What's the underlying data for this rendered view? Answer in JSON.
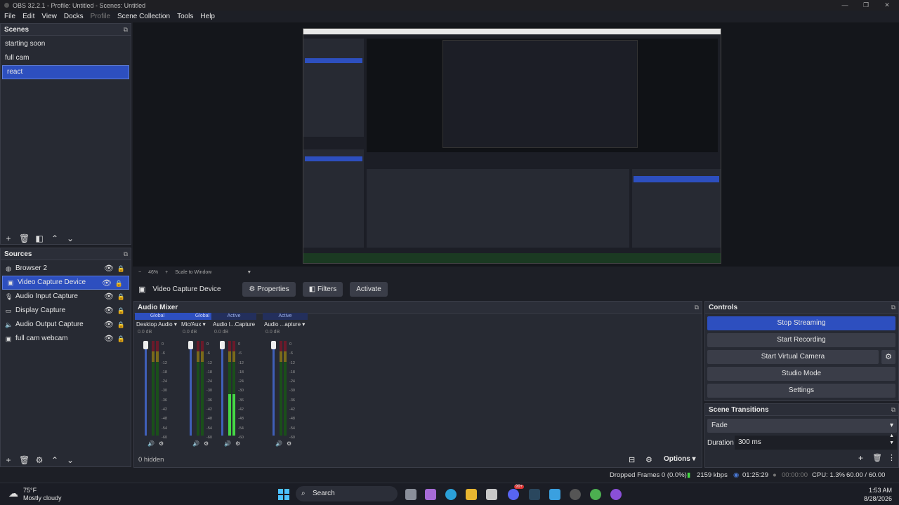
{
  "window": {
    "title": "OBS 32.2.1 - Profile: Untitled - Scenes: Untitled",
    "minimize": "—",
    "maximize": "❐",
    "close": "✕"
  },
  "menu": [
    "File",
    "Edit",
    "View",
    "Docks",
    "Profile",
    "Scene Collection",
    "Tools",
    "Help"
  ],
  "scenes": {
    "title": "Scenes",
    "items": [
      "starting soon",
      "full cam",
      "react"
    ],
    "selected": "react"
  },
  "sources": {
    "title": "Sources",
    "items": [
      {
        "label": "Browser 2",
        "icon": "globe-icon"
      },
      {
        "label": "Video Capture Device",
        "icon": "camera-icon"
      },
      {
        "label": "Audio Input Capture",
        "icon": "microphone-icon"
      },
      {
        "label": "Display Capture",
        "icon": "monitor-icon"
      },
      {
        "label": "Audio Output Capture",
        "icon": "speaker-icon"
      },
      {
        "label": "full cam webcam",
        "icon": "camera-icon"
      }
    ],
    "selected": "Video Capture Device"
  },
  "preview": {
    "zoom": "46%",
    "scale_mode": "Scale to Window"
  },
  "context": {
    "source_name": "Video Capture Device",
    "properties": "Properties",
    "filters": "Filters",
    "activate": "Activate"
  },
  "mixer": {
    "title": "Audio Mixer",
    "hidden": "0 hidden",
    "options": "Options",
    "ticks": [
      "0",
      "-6",
      "-12",
      "-18",
      "-24",
      "-30",
      "-36",
      "-42",
      "-48",
      "-54",
      "-60"
    ],
    "channels": [
      {
        "state": "Global",
        "name": "Desktop Audio",
        "db": "0.0 dB",
        "level": 0
      },
      {
        "state": "Global",
        "name": "Mic/Aux",
        "db": "0.0 dB",
        "level": 0
      },
      {
        "state": "Active",
        "name": "Audio I...Capture",
        "db": "0.0 dB",
        "level": 0.62
      },
      {
        "state": "Active",
        "name": "Audio ...apture",
        "db": "0.0 dB",
        "level": 0
      }
    ]
  },
  "controls": {
    "title": "Controls",
    "stop_streaming": "Stop Streaming",
    "start_recording": "Start Recording",
    "start_virtual_camera": "Start Virtual Camera",
    "studio_mode": "Studio Mode",
    "settings": "Settings"
  },
  "transitions": {
    "title": "Scene Transitions",
    "selected": "Fade",
    "duration_label": "Duration",
    "duration_value": "300 ms"
  },
  "status": {
    "dropped": "Dropped Frames 0 (0.0%)",
    "bitrate": "2159 kbps",
    "stream_time": "01:25:29",
    "record_time": "00:00:00",
    "cpu": "CPU: 1.3%",
    "fps": "60.00 / 60.00 FPS"
  },
  "taskbar": {
    "temp": "75°F",
    "weather": "Mostly cloudy",
    "search_placeholder": "Search",
    "time": "1:53 AM",
    "date": "8/28/2026",
    "badge": "99+"
  },
  "colors": {
    "accent": "#2d4fbf",
    "panel": "#272a33",
    "background": "#1d1f26"
  }
}
